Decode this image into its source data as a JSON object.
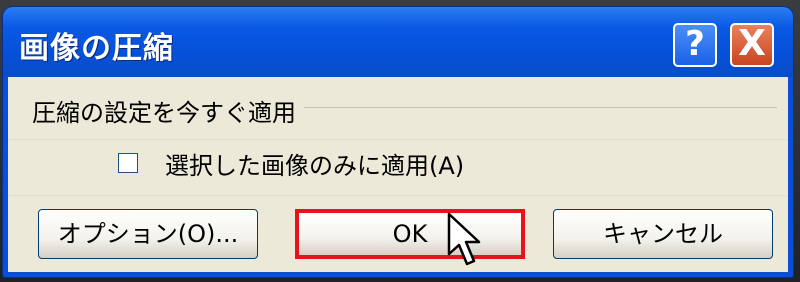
{
  "dialog": {
    "title": "画像の圧縮",
    "help_glyph": "?",
    "close_glyph": "X"
  },
  "group": {
    "label": "圧縮の設定を今すぐ適用"
  },
  "checkbox": {
    "label": "選択した画像のみに適用(A)",
    "checked": false
  },
  "buttons": {
    "options": "オプション(O)...",
    "ok": "OK",
    "cancel": "キャンセル"
  },
  "colors": {
    "titlebar": "#0650d8",
    "client": "#ece9d8",
    "highlight": "#e8121c",
    "close": "#c94520"
  },
  "icons": {
    "help": "help-icon",
    "close": "close-icon",
    "cursor": "mouse-pointer-icon"
  }
}
